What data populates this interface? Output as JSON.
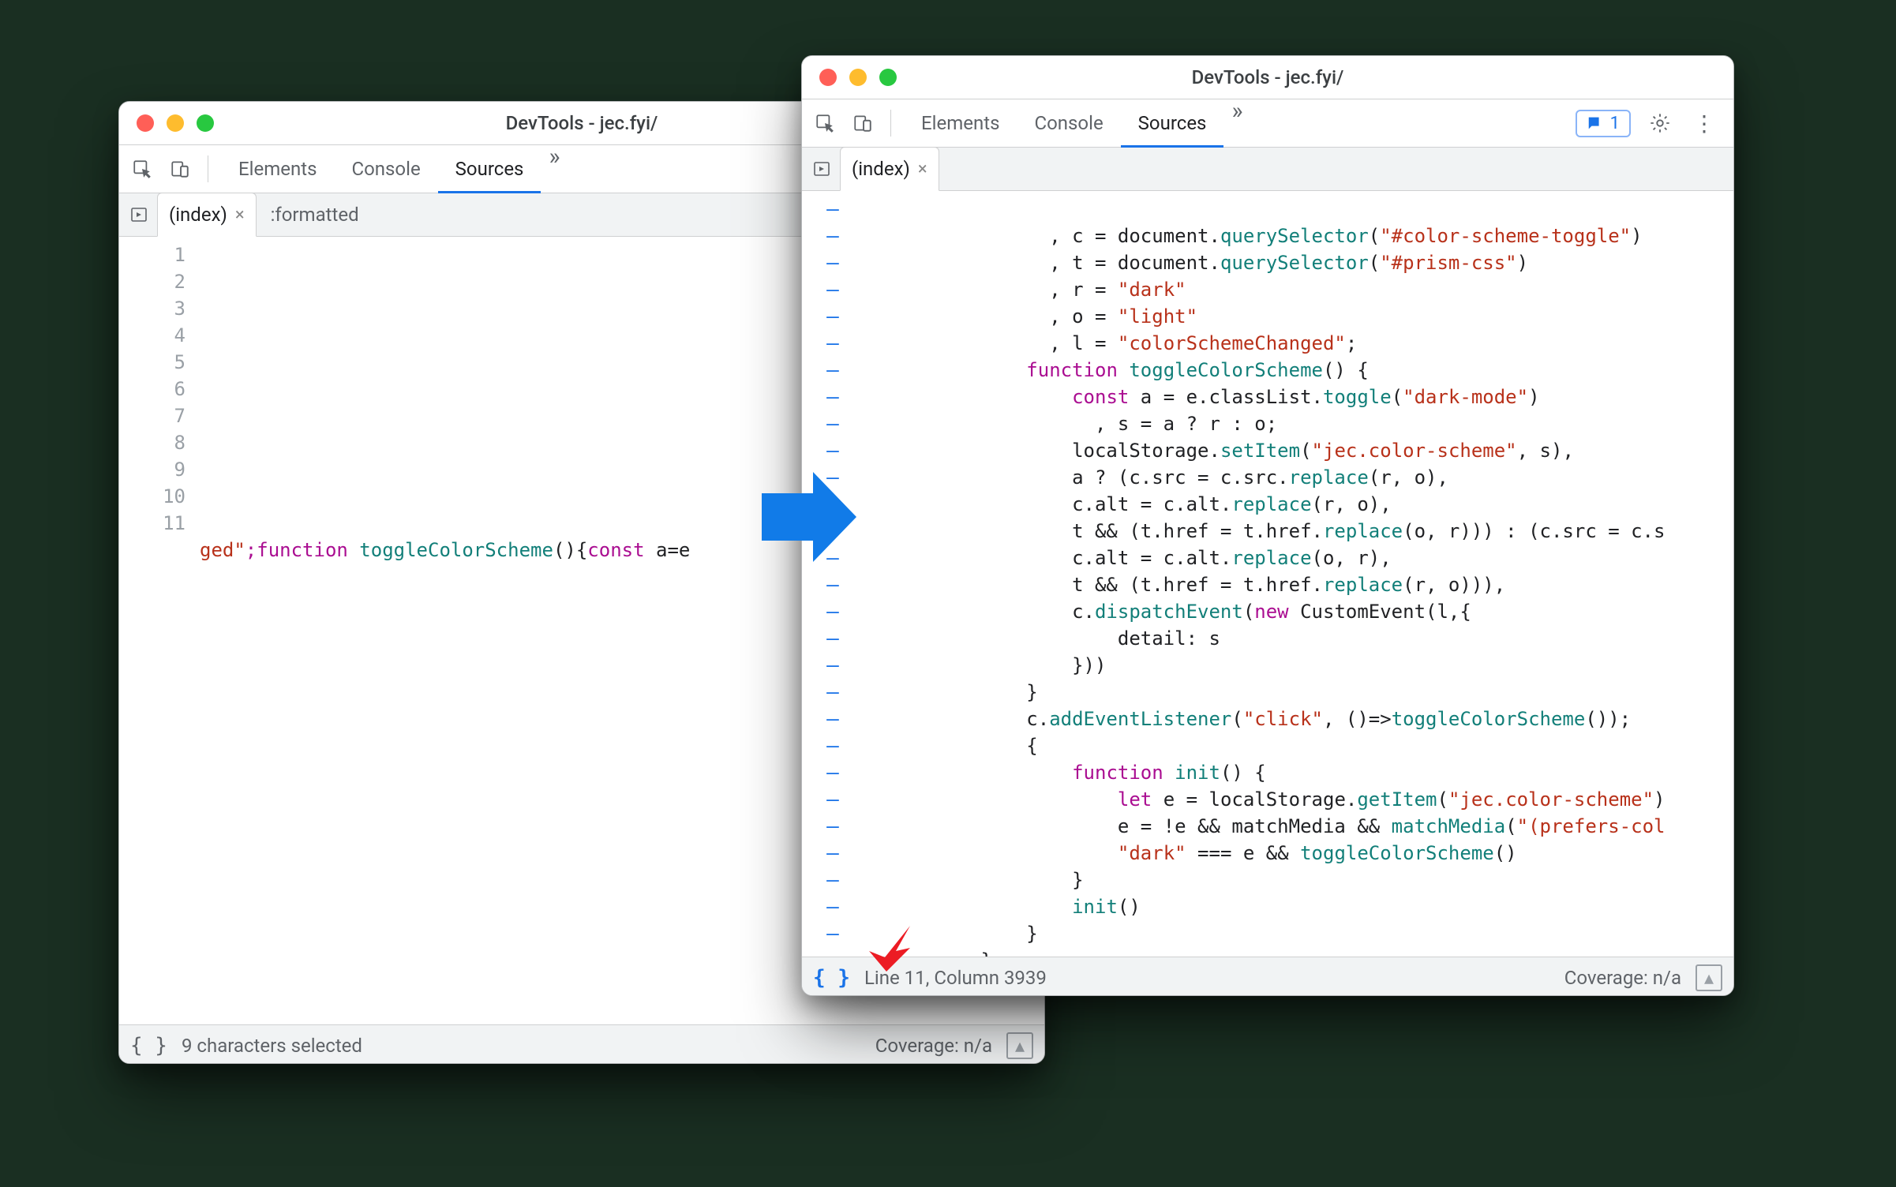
{
  "colors": {
    "accent": "#1a73e8",
    "string": "#b8311a",
    "keyword": "#aa0d91",
    "teal": "#127f79"
  },
  "w1": {
    "title": "DevTools - jec.fyi/",
    "tabs": {
      "elements": "Elements",
      "console": "Console",
      "sources": "Sources",
      "more": "»"
    },
    "strip": {
      "file": "(index)",
      "formatted": ":formatted"
    },
    "gutter": [
      "1",
      "2",
      "3",
      "4",
      "5",
      "6",
      "7",
      "8",
      "9",
      "10",
      "11"
    ],
    "codeLine": {
      "frag1": "ged\"",
      "kw1": ";function",
      "fn": " toggleColorScheme",
      "paren": "(){",
      "kw2": "const",
      "rest": " a=e"
    },
    "status": {
      "pp": "{ }",
      "text": "9 characters selected",
      "coverage": "Coverage: n/a"
    }
  },
  "w2": {
    "title": "DevTools - jec.fyi/",
    "tabs": {
      "elements": "Elements",
      "console": "Console",
      "sources": "Sources",
      "more": "»"
    },
    "issues": {
      "count": "1"
    },
    "strip": {
      "file": "(index)"
    },
    "gutterMark": "–",
    "gutterCount": 24,
    "code": {
      "l1": {
        "a": "                , c = document.",
        "b": "querySelector",
        "c": "(",
        "d": "\"#color-scheme-toggle\"",
        "e": ")"
      },
      "l2": {
        "a": "                , t = document.",
        "b": "querySelector",
        "c": "(",
        "d": "\"#prism-css\"",
        "e": ")"
      },
      "l3": {
        "a": "                , r = ",
        "b": "\"dark\""
      },
      "l4": {
        "a": "                , o = ",
        "b": "\"light\""
      },
      "l5": {
        "a": "                , l = ",
        "b": "\"colorSchemeChanged\"",
        "c": ";"
      },
      "l6": {
        "a": "              ",
        "kw": "function",
        "sp": " ",
        "fn": "toggleColorScheme",
        "rest": "() {"
      },
      "l7": {
        "a": "                  ",
        "kw": "const",
        "rest": " a = e.classList.",
        "m": "toggle",
        "p": "(",
        "s": "\"dark-mode\"",
        "e": ")"
      },
      "l8": {
        "a": "                    , s = a ? r : o;"
      },
      "l9": {
        "a": "                  localStorage.",
        "m": "setItem",
        "p": "(",
        "s": "\"jec.color-scheme\"",
        "rest": ", s),"
      },
      "l10": {
        "a": "                  a ? (c.src = c.src.",
        "m": "replace",
        "rest": "(r, o),"
      },
      "l11": {
        "a": "                  c.alt = c.alt.",
        "m": "replace",
        "rest": "(r, o),"
      },
      "l12": {
        "a": "                  t && (t.href = t.href.",
        "m": "replace",
        "rest": "(o, r))) : (c.src = c.s"
      },
      "l13": {
        "a": "                  c.alt = c.alt.",
        "m": "replace",
        "rest": "(o, r),"
      },
      "l14": {
        "a": "                  t && (t.href = t.href.",
        "m": "replace",
        "rest": "(r, o))),"
      },
      "l15": {
        "a": "                  c.",
        "m": "dispatchEvent",
        "p": "(",
        "kw": "new",
        "rest": " CustomEvent(l,{"
      },
      "l16": {
        "a": "                      detail: s"
      },
      "l17": {
        "a": "                  }))"
      },
      "l18": {
        "a": "              }"
      },
      "l19": {
        "a": "              c.",
        "m": "addEventListener",
        "p": "(",
        "s": "\"click\"",
        "rest": ", ()=>",
        "fn": "toggleColorScheme",
        "e": "());"
      },
      "l20": {
        "a": "              {"
      },
      "l21": {
        "a": "                  ",
        "kw": "function",
        "sp": " ",
        "fn": "init",
        "rest": "() {"
      },
      "l22": {
        "a": "                      ",
        "kw": "let",
        "rest": " e = localStorage.",
        "m": "getItem",
        "p": "(",
        "s": "\"jec.color-scheme\"",
        "e": ")"
      },
      "l23": {
        "a": "                      e = !e && matchMedia && ",
        "fn": "matchMedia",
        "p": "(",
        "s": "\"(prefers-col"
      },
      "l24": {
        "a": "                      ",
        "s": "\"dark\"",
        "rest": " === e && ",
        "fn": "toggleColorScheme",
        "e": "()"
      },
      "l25": {
        "a": "                  }"
      },
      "l26": {
        "a": "                  ",
        "fn": "init",
        "e": "()"
      },
      "l27": {
        "a": "              }"
      },
      "l28": {
        "a": "          }"
      }
    },
    "status": {
      "pp": "{ }",
      "text": "Line 11, Column 3939",
      "coverage": "Coverage: n/a"
    }
  }
}
